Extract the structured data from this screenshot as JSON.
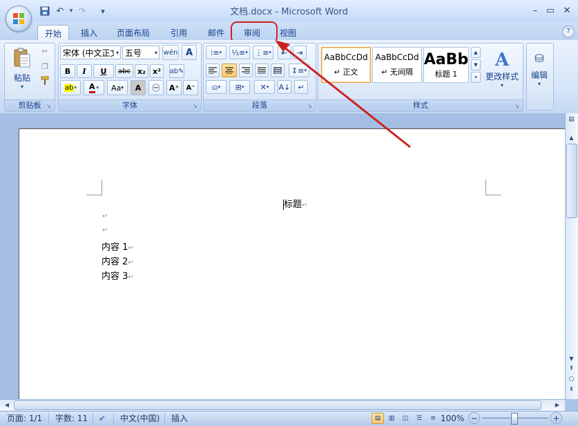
{
  "window": {
    "title": "文档.docx - Microsoft Word",
    "minimize": "–",
    "restore": "▭",
    "close": "✕"
  },
  "qat": {
    "save": "save-icon",
    "undo": "undo-icon",
    "redo": "redo-icon",
    "customize": "▾"
  },
  "tabs": [
    {
      "label": "开始",
      "active": true
    },
    {
      "label": "插入"
    },
    {
      "label": "页面布局"
    },
    {
      "label": "引用"
    },
    {
      "label": "邮件"
    },
    {
      "label": "审阅",
      "highlighted": true
    },
    {
      "label": "视图"
    }
  ],
  "help": "?",
  "ribbon": {
    "clipboard": {
      "label": "剪贴板",
      "paste": "粘贴"
    },
    "font": {
      "label": "字体",
      "font_name": "宋体 (中文正文)",
      "font_size": "五号",
      "buttons": [
        "B",
        "I",
        "U",
        "abc",
        "x₂",
        "x²",
        "Aa",
        "A",
        "A"
      ]
    },
    "paragraph": {
      "label": "段落"
    },
    "styles": {
      "label": "样式",
      "items": [
        {
          "preview": "AaBbCcDd",
          "name": "↵ 正文",
          "selected": true
        },
        {
          "preview": "AaBbCcDd",
          "name": "↵ 无间隔"
        },
        {
          "preview": "AaBb",
          "name": "标题 1"
        }
      ],
      "change_styles": "更改样式"
    },
    "editing": {
      "label": "编辑"
    }
  },
  "document": {
    "title": "标题",
    "lines": [
      "内容 1",
      "内容 2",
      "内容 3"
    ],
    "para_mark": "↵"
  },
  "statusbar": {
    "page": "页面: 1/1",
    "words": "字数: 11",
    "language": "中文(中国)",
    "mode": "插入",
    "zoom": "100%"
  },
  "colors": {
    "accent": "#15428b",
    "annotation": "#cc2222"
  }
}
